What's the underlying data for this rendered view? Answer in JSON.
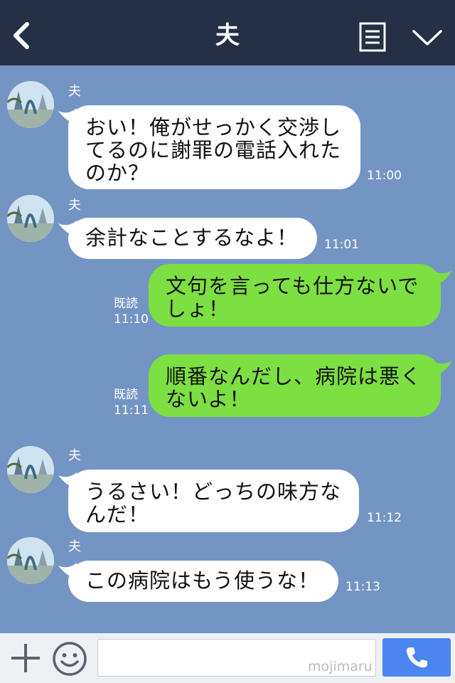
{
  "header": {
    "title": "夫",
    "back_icon": "back-icon",
    "menu_icon": "menu-icon",
    "collapse_icon": "chevron-down-icon",
    "background": "#253046"
  },
  "chat": {
    "background": "#7395c4",
    "messages": [
      {
        "direction": "in",
        "sender": "夫",
        "text": "おい！俺がせっかく交渉し\nてるのに謝罪の電話入れた\nのか？",
        "time": "11:00"
      },
      {
        "direction": "in",
        "sender": "夫",
        "text": "余計なことするなよ！",
        "time": "11:01"
      },
      {
        "direction": "out",
        "read": "既読",
        "text": "文句を言っても仕方ないで\nしょ！",
        "time": "11:10"
      },
      {
        "direction": "out",
        "read": "既読",
        "text": "順番なんだし、病院は悪く\nないよ！",
        "time": "11:11"
      },
      {
        "direction": "in",
        "sender": "夫",
        "text": "うるさい！どっちの味方な\nんだ！",
        "time": "11:12"
      },
      {
        "direction": "in",
        "sender": "夫",
        "text": "この病院はもう使うな！",
        "time": "11:13"
      }
    ]
  },
  "footer": {
    "plus_icon": "plus-icon",
    "sticker_icon": "smile-icon",
    "input_value": "",
    "watermark": "mojimaru",
    "call_icon": "phone-icon",
    "call_button_color": "#4b86f0"
  },
  "colors": {
    "incoming_bubble": "#ffffff",
    "outgoing_bubble": "#7ddf41"
  }
}
